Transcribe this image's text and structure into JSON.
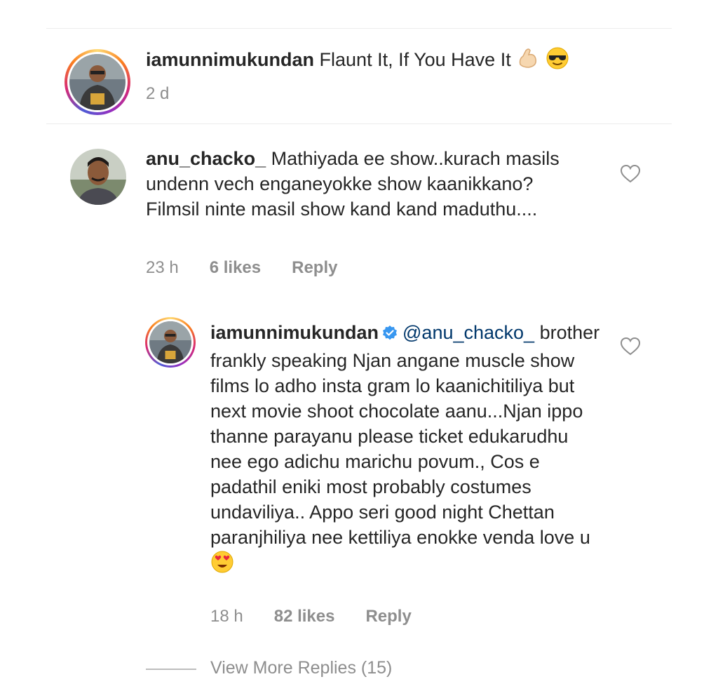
{
  "post": {
    "username": "iamunnimukundan",
    "caption": "Flaunt It, If You Have It",
    "caption_emojis": [
      "flexed-biceps",
      "sunglasses-face"
    ],
    "time": "2 d"
  },
  "comment": {
    "username": "anu_chacko_",
    "text": "Mathiyada ee show..kurach masils undenn vech enganeyokke show kaanikkano? Filmsil ninte masil show kand kand maduthu....",
    "time": "23 h",
    "likes": "6 likes",
    "reply_label": "Reply"
  },
  "reply": {
    "username": "iamunnimukundan",
    "verified": true,
    "mention": "@anu_chacko_",
    "text": "brother frankly speaking Njan angane muscle show films lo adho insta gram lo kaanichitiliya but next movie shoot chocolate aanu...Njan ippo thanne parayanu please ticket edukarudhu nee ego adichu marichu povum., Cos e padathil eniki most probably costumes undaviliya.. Appo seri good night Chettan paranjhiliya nee kettiliya enokke venda love u",
    "end_emoji": "heart-eyes-face",
    "time": "18 h",
    "likes": "82 likes",
    "reply_label": "Reply"
  },
  "view_more": "View More Replies (15)",
  "colors": {
    "text": "#262626",
    "secondary": "#8e8e8e",
    "mention": "#00376b",
    "verified": "#3897f0"
  }
}
